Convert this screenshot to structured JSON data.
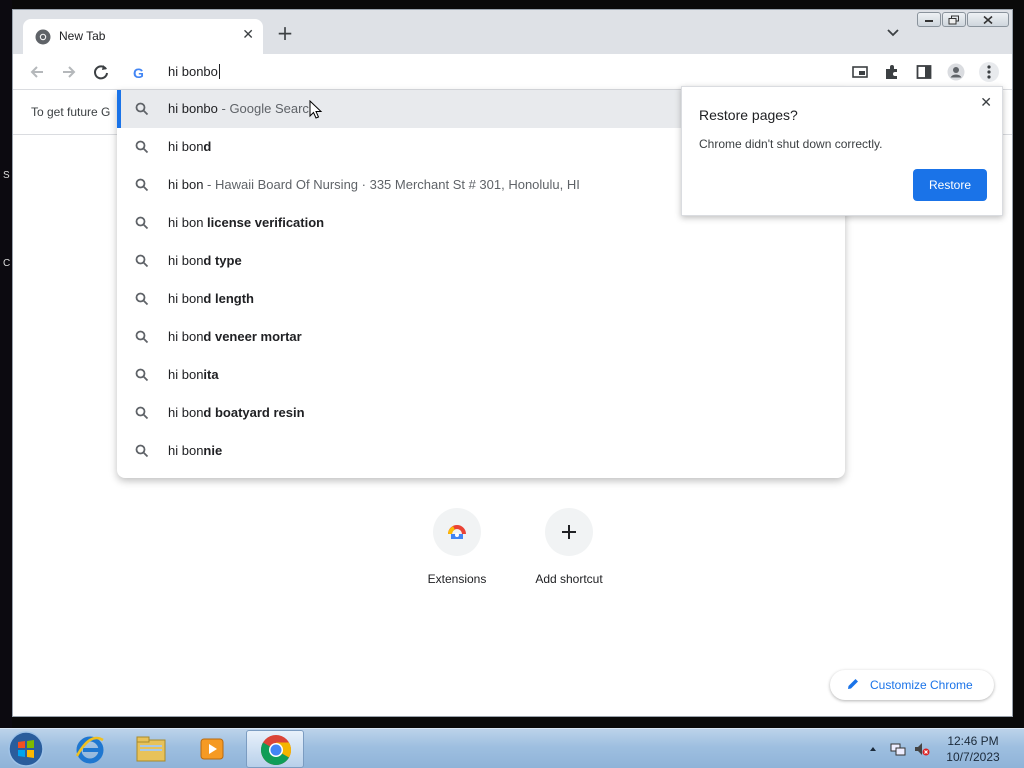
{
  "desktop": {
    "edge_text_1": "S",
    "edge_text_2": "C"
  },
  "tab": {
    "title": "New Tab",
    "close_glyph": "✕",
    "icon": "chrome-icon"
  },
  "tabstrip": {
    "new_tab_glyph": "+"
  },
  "omnibox": {
    "logo_letter": "G",
    "value": "hi bonbo"
  },
  "infobar": {
    "text": "To get future G"
  },
  "suggestions": [
    {
      "prefix": "hi bonbo",
      "bold": "",
      "suffix": " - Google Search",
      "selected": true
    },
    {
      "prefix": "hi bon",
      "bold": "d",
      "suffix": "",
      "selected": false
    },
    {
      "prefix": "hi bon",
      "bold": "",
      "suffix": " - Hawaii Board Of Nursing · 335 Merchant St # 301, Honolulu, HI",
      "selected": false
    },
    {
      "prefix": "hi bon ",
      "bold": "license verification",
      "suffix": "",
      "selected": false
    },
    {
      "prefix": "hi bon",
      "bold": "d type",
      "suffix": "",
      "selected": false
    },
    {
      "prefix": "hi bon",
      "bold": "d length",
      "suffix": "",
      "selected": false
    },
    {
      "prefix": "hi bon",
      "bold": "d veneer mortar",
      "suffix": "",
      "selected": false
    },
    {
      "prefix": "hi bon",
      "bold": "ita",
      "suffix": "",
      "selected": false
    },
    {
      "prefix": "hi bon",
      "bold": "d boatyard resin",
      "suffix": "",
      "selected": false
    },
    {
      "prefix": "hi bon",
      "bold": "nie",
      "suffix": "",
      "selected": false
    }
  ],
  "shortcuts": [
    {
      "label": "Extensions",
      "icon": "chrome-webstore-icon"
    },
    {
      "label": "Add shortcut",
      "icon": "plus-icon"
    }
  ],
  "customize": {
    "label": "Customize Chrome"
  },
  "restore_bubble": {
    "title": "Restore pages?",
    "message": "Chrome didn't shut down correctly.",
    "button": "Restore",
    "close_glyph": "✕"
  },
  "taskbar": {
    "apps": [
      "internet-explorer",
      "file-explorer",
      "media-player",
      "chrome"
    ],
    "time": "12:46 PM",
    "date": "10/7/2023"
  },
  "colors": {
    "accent": "#1a73e8",
    "tab_strip": "#dee1e6",
    "selected_row": "#e8eaed"
  }
}
